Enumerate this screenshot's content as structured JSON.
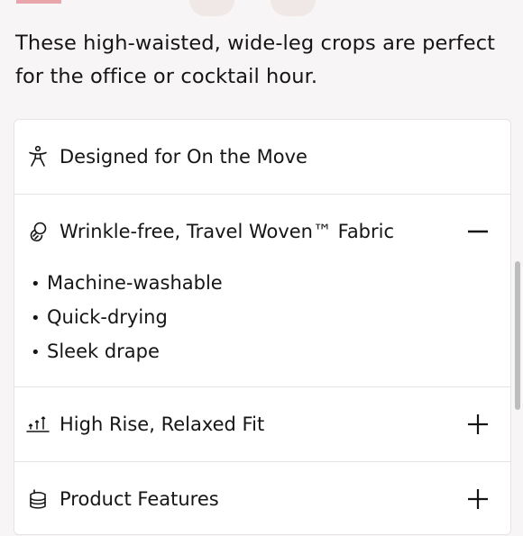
{
  "product": {
    "description": "These high-waisted, wide-leg crops are perfect for the office or cocktail hour."
  },
  "accordion": {
    "items": [
      {
        "title": "Designed for On the Move",
        "icon": "person-moving-icon"
      },
      {
        "title": "Wrinkle-free, Travel Woven™ Fabric",
        "icon": "fabric-icon",
        "toggle": "collapse",
        "expanded": true,
        "bullets": [
          "Machine-washable",
          "Quick-drying",
          "Sleek drape"
        ]
      },
      {
        "title": "High Rise, Relaxed Fit",
        "icon": "rise-arrows-icon",
        "toggle": "expand"
      },
      {
        "title": "Product Features",
        "icon": "features-icon",
        "toggle": "expand"
      }
    ]
  },
  "colors": {
    "accent": "#e8a5ac",
    "text": "#151515",
    "divider": "#e4e4e4"
  }
}
